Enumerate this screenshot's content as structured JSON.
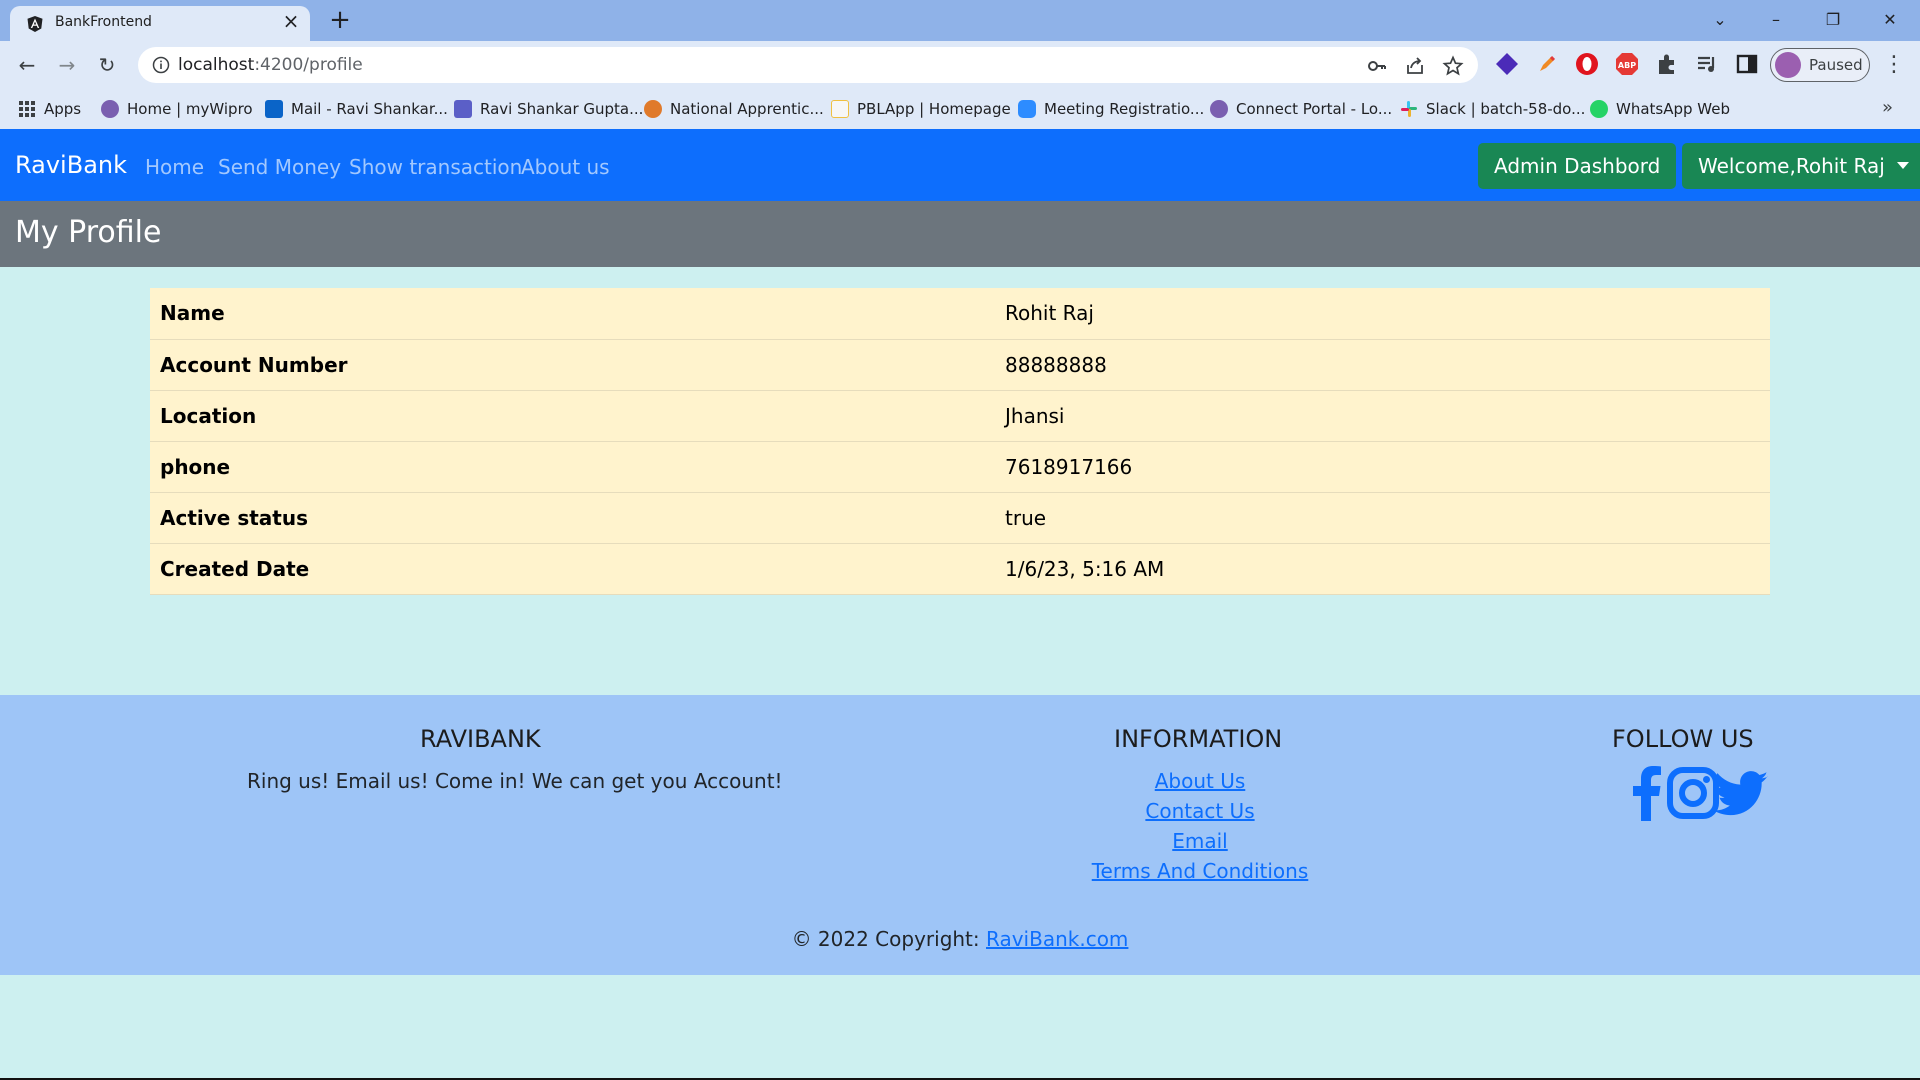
{
  "browser": {
    "tab_title": "BankFrontend",
    "url_host": "localhost",
    "url_rest": ":4200/profile",
    "profile_label": "Paused",
    "bookmarks": [
      {
        "label": "Apps",
        "icon_color": "#5f6368"
      },
      {
        "label": "Home | myWipro",
        "icon_color": "#7a5fb0"
      },
      {
        "label": "Mail - Ravi Shankar...",
        "icon_color": "#0a64c8"
      },
      {
        "label": "Ravi Shankar Gupta...",
        "icon_color": "#5b5fc7"
      },
      {
        "label": "National Apprentic...",
        "icon_color": "#e07a2b"
      },
      {
        "label": "PBLApp | Homepage",
        "icon_color": "#f0c040"
      },
      {
        "label": "Meeting Registratio...",
        "icon_color": "#2d8cff"
      },
      {
        "label": "Connect Portal - Lo...",
        "icon_color": "#7a5fb0"
      },
      {
        "label": "Slack | batch-58-do...",
        "icon_color": "#e01e5a"
      },
      {
        "label": "WhatsApp Web",
        "icon_color": "#25d366"
      }
    ]
  },
  "navbar": {
    "brand": "RaviBank",
    "links": [
      "Home",
      "Send Money",
      "Show transaction",
      "About us"
    ],
    "admin_button": "Admin Dashbord",
    "user_menu": "Welcome,Rohit Raj"
  },
  "page": {
    "title": "My Profile"
  },
  "profile": {
    "rows": [
      {
        "label": "Name",
        "value": "Rohit Raj"
      },
      {
        "label": "Account Number",
        "value": "88888888"
      },
      {
        "label": "Location",
        "value": "Jhansi"
      },
      {
        "label": "phone",
        "value": "7618917166"
      },
      {
        "label": "Active status",
        "value": "true"
      },
      {
        "label": "Created Date",
        "value": "1/6/23, 5:16 AM"
      }
    ]
  },
  "footer": {
    "brand_heading": "RAVIBANK",
    "tagline": "Ring us! Email us! Come in! We can get you Account!",
    "info_heading": "INFORMATION",
    "info_links": [
      "About Us",
      "Contact Us",
      "Email",
      "Terms And Conditions"
    ],
    "follow_heading": "FOLLOW US",
    "copyright_prefix": "© 2022 Copyright: ",
    "copyright_link": "RaviBank.com"
  },
  "colors": {
    "navbar_bg": "#0d6efd",
    "title_bar_bg": "#6c757d",
    "table_bg": "#fff3cd",
    "page_bg": "#cdf0f0",
    "footer_bg": "#9ec5f7",
    "success": "#198754"
  }
}
